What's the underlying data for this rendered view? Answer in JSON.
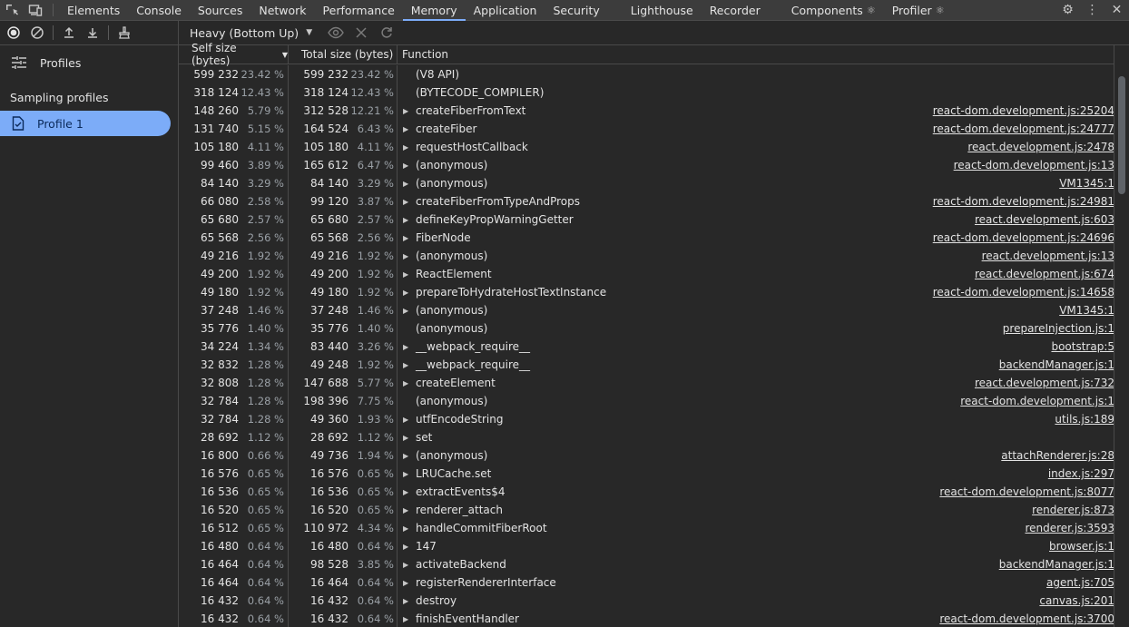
{
  "tabs": [
    {
      "label": "Elements",
      "active": false,
      "icon": false
    },
    {
      "label": "Console",
      "active": false,
      "icon": false
    },
    {
      "label": "Sources",
      "active": false,
      "icon": false
    },
    {
      "label": "Network",
      "active": false,
      "icon": false
    },
    {
      "label": "Performance",
      "active": false,
      "icon": false
    },
    {
      "label": "Memory",
      "active": true,
      "icon": false
    },
    {
      "label": "Application",
      "active": false,
      "icon": false
    },
    {
      "label": "Security",
      "active": false,
      "icon": false
    },
    {
      "label": "Lighthouse",
      "active": false,
      "icon": false
    },
    {
      "label": "Recorder",
      "active": false,
      "icon": false
    },
    {
      "label": "Components",
      "active": false,
      "icon": true
    },
    {
      "label": "Profiler",
      "active": false,
      "icon": true
    }
  ],
  "sidebar": {
    "profiles_label": "Profiles",
    "section_label": "Sampling profiles",
    "item_label": "Profile 1"
  },
  "toolbar": {
    "view_select": "Heavy (Bottom Up)"
  },
  "columns": {
    "self": "Self size (bytes)",
    "total": "Total size (bytes)",
    "function": "Function"
  },
  "rows": [
    {
      "self": "599 232",
      "self_pct": "23.42 %",
      "total": "599 232",
      "total_pct": "23.42 %",
      "fn": "(V8 API)",
      "src": "",
      "expand": false
    },
    {
      "self": "318 124",
      "self_pct": "12.43 %",
      "total": "318 124",
      "total_pct": "12.43 %",
      "fn": "(BYTECODE_COMPILER)",
      "src": "",
      "expand": false
    },
    {
      "self": "148 260",
      "self_pct": "5.79 %",
      "total": "312 528",
      "total_pct": "12.21 %",
      "fn": "createFiberFromText",
      "src": "react-dom.development.js:25204",
      "expand": true
    },
    {
      "self": "131 740",
      "self_pct": "5.15 %",
      "total": "164 524",
      "total_pct": "6.43 %",
      "fn": "createFiber",
      "src": "react-dom.development.js:24777",
      "expand": true
    },
    {
      "self": "105 180",
      "self_pct": "4.11 %",
      "total": "105 180",
      "total_pct": "4.11 %",
      "fn": "requestHostCallback",
      "src": "react.development.js:2478",
      "expand": true
    },
    {
      "self": "99 460",
      "self_pct": "3.89 %",
      "total": "165 612",
      "total_pct": "6.47 %",
      "fn": "(anonymous)",
      "src": "react-dom.development.js:13",
      "expand": true
    },
    {
      "self": "84 140",
      "self_pct": "3.29 %",
      "total": "84 140",
      "total_pct": "3.29 %",
      "fn": "(anonymous)",
      "src": "VM1345:1",
      "expand": true
    },
    {
      "self": "66 080",
      "self_pct": "2.58 %",
      "total": "99 120",
      "total_pct": "3.87 %",
      "fn": "createFiberFromTypeAndProps",
      "src": "react-dom.development.js:24981",
      "expand": true
    },
    {
      "self": "65 680",
      "self_pct": "2.57 %",
      "total": "65 680",
      "total_pct": "2.57 %",
      "fn": "defineKeyPropWarningGetter",
      "src": "react.development.js:603",
      "expand": true
    },
    {
      "self": "65 568",
      "self_pct": "2.56 %",
      "total": "65 568",
      "total_pct": "2.56 %",
      "fn": "FiberNode",
      "src": "react-dom.development.js:24696",
      "expand": true
    },
    {
      "self": "49 216",
      "self_pct": "1.92 %",
      "total": "49 216",
      "total_pct": "1.92 %",
      "fn": "(anonymous)",
      "src": "react.development.js:13",
      "expand": true
    },
    {
      "self": "49 200",
      "self_pct": "1.92 %",
      "total": "49 200",
      "total_pct": "1.92 %",
      "fn": "ReactElement",
      "src": "react.development.js:674",
      "expand": true
    },
    {
      "self": "49 180",
      "self_pct": "1.92 %",
      "total": "49 180",
      "total_pct": "1.92 %",
      "fn": "prepareToHydrateHostTextInstance",
      "src": "react-dom.development.js:14658",
      "expand": true
    },
    {
      "self": "37 248",
      "self_pct": "1.46 %",
      "total": "37 248",
      "total_pct": "1.46 %",
      "fn": "(anonymous)",
      "src": "VM1345:1",
      "expand": true
    },
    {
      "self": "35 776",
      "self_pct": "1.40 %",
      "total": "35 776",
      "total_pct": "1.40 %",
      "fn": "(anonymous)",
      "src": "prepareInjection.js:1",
      "expand": false
    },
    {
      "self": "34 224",
      "self_pct": "1.34 %",
      "total": "83 440",
      "total_pct": "3.26 %",
      "fn": "__webpack_require__",
      "src": "bootstrap:5",
      "expand": true
    },
    {
      "self": "32 832",
      "self_pct": "1.28 %",
      "total": "49 248",
      "total_pct": "1.92 %",
      "fn": "__webpack_require__",
      "src": "backendManager.js:1",
      "expand": true
    },
    {
      "self": "32 808",
      "self_pct": "1.28 %",
      "total": "147 688",
      "total_pct": "5.77 %",
      "fn": "createElement",
      "src": "react.development.js:732",
      "expand": true
    },
    {
      "self": "32 784",
      "self_pct": "1.28 %",
      "total": "198 396",
      "total_pct": "7.75 %",
      "fn": "(anonymous)",
      "src": "react-dom.development.js:1",
      "expand": false
    },
    {
      "self": "32 784",
      "self_pct": "1.28 %",
      "total": "49 360",
      "total_pct": "1.93 %",
      "fn": "utfEncodeString",
      "src": "utils.js:189",
      "expand": true
    },
    {
      "self": "28 692",
      "self_pct": "1.12 %",
      "total": "28 692",
      "total_pct": "1.12 %",
      "fn": "set",
      "src": "",
      "expand": true
    },
    {
      "self": "16 800",
      "self_pct": "0.66 %",
      "total": "49 736",
      "total_pct": "1.94 %",
      "fn": "(anonymous)",
      "src": "attachRenderer.js:28",
      "expand": true
    },
    {
      "self": "16 576",
      "self_pct": "0.65 %",
      "total": "16 576",
      "total_pct": "0.65 %",
      "fn": "LRUCache.set",
      "src": "index.js:297",
      "expand": true
    },
    {
      "self": "16 536",
      "self_pct": "0.65 %",
      "total": "16 536",
      "total_pct": "0.65 %",
      "fn": "extractEvents$4",
      "src": "react-dom.development.js:8077",
      "expand": true
    },
    {
      "self": "16 520",
      "self_pct": "0.65 %",
      "total": "16 520",
      "total_pct": "0.65 %",
      "fn": "renderer_attach",
      "src": "renderer.js:873",
      "expand": true
    },
    {
      "self": "16 512",
      "self_pct": "0.65 %",
      "total": "110 972",
      "total_pct": "4.34 %",
      "fn": "handleCommitFiberRoot",
      "src": "renderer.js:3593",
      "expand": true
    },
    {
      "self": "16 480",
      "self_pct": "0.64 %",
      "total": "16 480",
      "total_pct": "0.64 %",
      "fn": "147",
      "src": "browser.js:1",
      "expand": true
    },
    {
      "self": "16 464",
      "self_pct": "0.64 %",
      "total": "98 528",
      "total_pct": "3.85 %",
      "fn": "activateBackend",
      "src": "backendManager.js:1",
      "expand": true
    },
    {
      "self": "16 464",
      "self_pct": "0.64 %",
      "total": "16 464",
      "total_pct": "0.64 %",
      "fn": "registerRendererInterface",
      "src": "agent.js:705",
      "expand": true
    },
    {
      "self": "16 432",
      "self_pct": "0.64 %",
      "total": "16 432",
      "total_pct": "0.64 %",
      "fn": "destroy",
      "src": "canvas.js:201",
      "expand": true
    },
    {
      "self": "16 432",
      "self_pct": "0.64 %",
      "total": "16 432",
      "total_pct": "0.64 %",
      "fn": "finishEventHandler",
      "src": "react-dom.development.js:3700",
      "expand": true
    }
  ]
}
